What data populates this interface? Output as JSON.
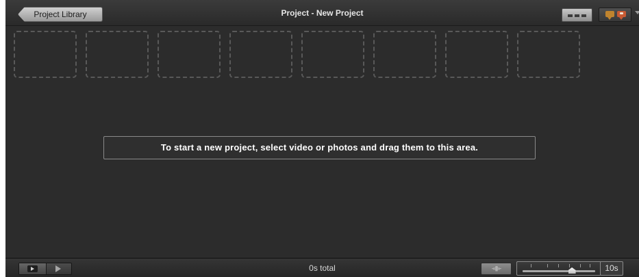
{
  "header": {
    "back_button": "Project Library",
    "title": "Project - New Project",
    "view_icon": "thumbnail-grid-icon",
    "comment_icons": [
      "comment-bubble-icon",
      "comment-bubble-add-icon"
    ]
  },
  "project_area": {
    "placeholder_count": 8,
    "hint": "To start a new project, select video or photos and drag them to this area."
  },
  "footer": {
    "play_fullscreen_icon": "play-fullscreen-icon",
    "play_icon": "play-icon",
    "total": "0s total",
    "audio_icon": "waveform-icon",
    "zoom_level": 0.68,
    "duration": "10s"
  },
  "colors": {
    "background": "#2c2c2c",
    "bubble_orange": "#c0842e",
    "bubble_red": "#c85a33"
  }
}
